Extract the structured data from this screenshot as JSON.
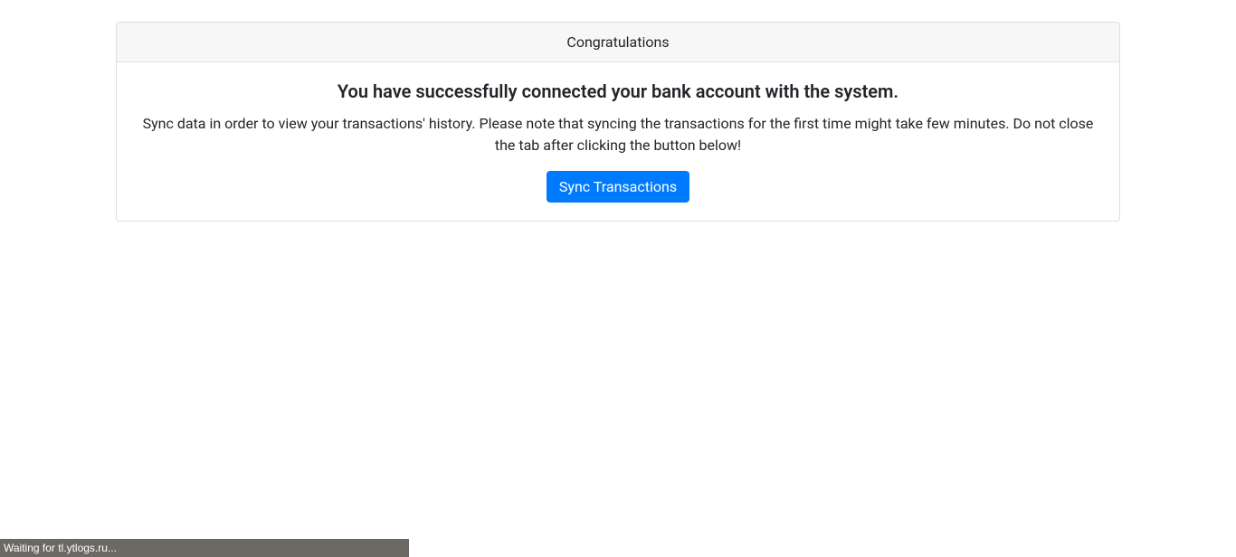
{
  "card": {
    "header": "Congratulations",
    "title": "You have successfully connected your bank account with the system.",
    "text": "Sync data in order to view your transactions' history. Please note that syncing the transactions for the first time might take few minutes. Do not close the tab after clicking the button below!",
    "button_label": "Sync Transactions"
  },
  "status_bar": {
    "text": "Waiting for tl.ytlogs.ru..."
  }
}
